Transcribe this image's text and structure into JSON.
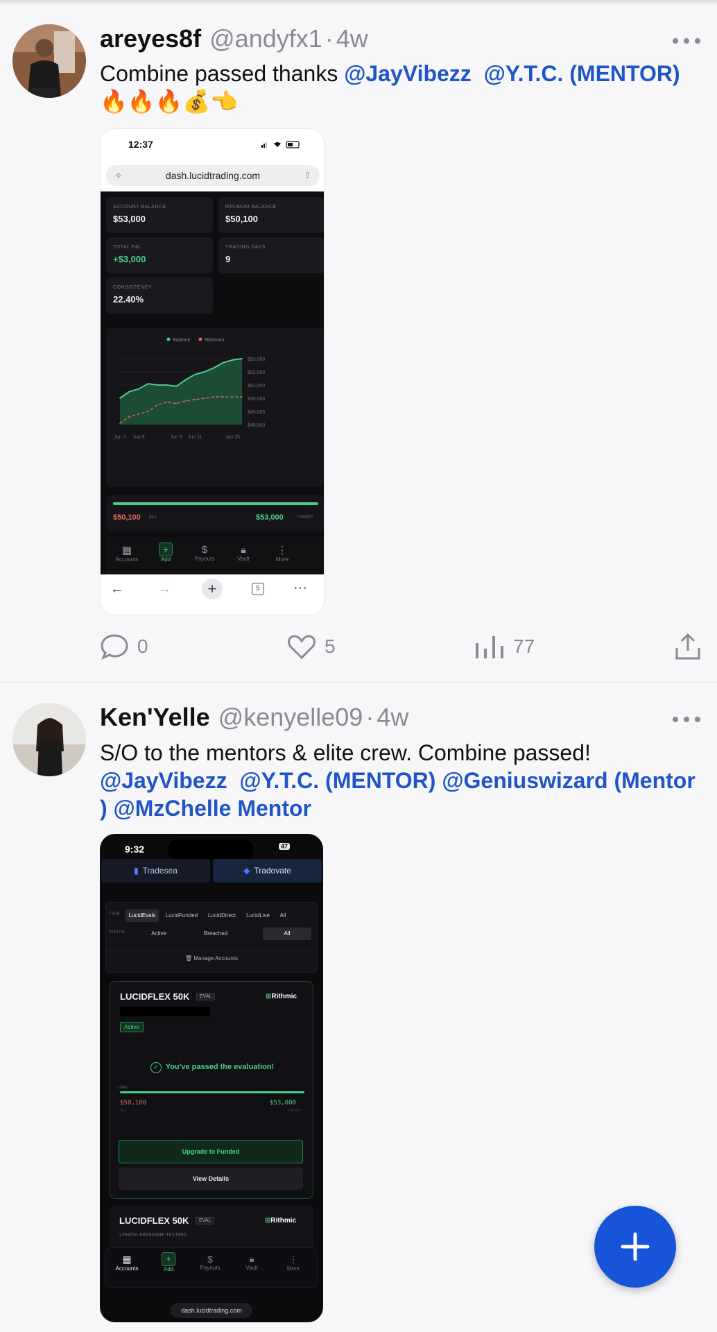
{
  "post1": {
    "name": "areyes8f",
    "handle": "@andyfx1",
    "time": "4w",
    "text_plain": "Combine passed thanks ",
    "mention1": "@JayVibezz",
    "mention2": "@Y.T.C. (MENTOR)",
    "emoji": "🔥🔥🔥💰👈",
    "actions": {
      "replies": "0",
      "likes": "5",
      "views": "77"
    },
    "phone": {
      "time": "12:37",
      "url": "dash.lucidtrading.com",
      "stats": [
        {
          "label": "ACCOUNT BALANCE",
          "value": "$53,000"
        },
        {
          "label": "MINIMUM BALANCE",
          "value": "$50,100"
        },
        {
          "label": "TOTAL P&L",
          "value": "+$3,000"
        },
        {
          "label": "TRADING DAYS",
          "value": "9"
        },
        {
          "label": "CONSISTENCY",
          "value": "22.40%"
        }
      ],
      "legend_balance": "Balance",
      "legend_minimum": "Minimum",
      "mll_value": "$50,100",
      "mll_label": "MLL",
      "target_value": "$53,000",
      "target_label": "TARGET",
      "nav": [
        "Accounts",
        "Add",
        "Payouts",
        "Vault",
        "More"
      ],
      "tabs_count": "5",
      "colors": {
        "balance": "#4ccf86",
        "minimum": "#e5695f",
        "pnl": "#4ccf86"
      }
    },
    "chart_data": {
      "type": "area",
      "x": [
        "Jun 3",
        "Jun 4",
        "Jun 5",
        "Jun 6",
        "Jun 7",
        "Jun 8",
        "Jun 9",
        "Jun 10",
        "Jun 11",
        "Jun 12",
        "Jun 13",
        "Jun 14",
        "Jun 15",
        "Jun 16"
      ],
      "x_tick_labels": [
        "Jun 3",
        "Jun 5",
        "Jun 9",
        "Jun 11",
        "Jun 15"
      ],
      "y_tick_labels": [
        "$53,000",
        "$52,000",
        "$51,000",
        "$50,000",
        "$49,000",
        "$48,000"
      ],
      "ylim": [
        48000,
        53000
      ],
      "series": [
        {
          "name": "Balance",
          "values": [
            50000,
            50500,
            50700,
            51100,
            51000,
            51000,
            50900,
            51400,
            51800,
            52000,
            52300,
            52700,
            52900,
            53000
          ]
        },
        {
          "name": "Minimum",
          "values": [
            48100,
            48600,
            48800,
            49000,
            49500,
            49700,
            49600,
            49800,
            49900,
            50000,
            50100,
            50100,
            50100,
            50100
          ]
        }
      ],
      "title": "",
      "xlabel": "",
      "ylabel": "",
      "grid": true,
      "legend": "top"
    }
  },
  "post2": {
    "name": "Ken'Yelle",
    "handle": "@kenyelle09",
    "time": "4w",
    "text_plain": "S/O to the mentors & elite crew. Combine passed!",
    "mention1": "@JayVibezz",
    "mention2": "@Y.T.C. (MENTOR)",
    "mention3": "@Geniuswizard (Mentor )",
    "mention4": "@MzChelle Mentor",
    "phone": {
      "time": "9:32",
      "battery": "47",
      "tab1": "Tradesea",
      "tab2": "Tradovate",
      "type_label": "TYPE",
      "type_chips": [
        "LucidEvals",
        "LucidFunded",
        "LucidDirect",
        "LucidLive",
        "All"
      ],
      "status_label": "STATUS",
      "status_chips": [
        "Active",
        "Breached",
        "All"
      ],
      "manage": "Manage Accounts",
      "card_title": "LUCIDFLEX 50K",
      "card_badge": "EVAL",
      "rithmic": "Rithmic",
      "active": "Active",
      "passed": "You've passed the evaluation!",
      "start_label": "START",
      "mll_value": "$50,100",
      "mll_label": "MLL",
      "target_value": "$53,000",
      "target_label": "TARGET",
      "upgrade": "Upgrade to Funded",
      "details": "View Details",
      "card2_title": "LUCIDFLEX 50K",
      "card2_badge": "EVAL",
      "card2_id": "LFE050-6RX9450M-TEST005",
      "nav": [
        "Accounts",
        "Add",
        "Payouts",
        "Vault",
        "More"
      ],
      "url": "dash.lucidtrading.com"
    }
  },
  "fab": {
    "icon": "plus-icon",
    "color": "#1754d8"
  }
}
